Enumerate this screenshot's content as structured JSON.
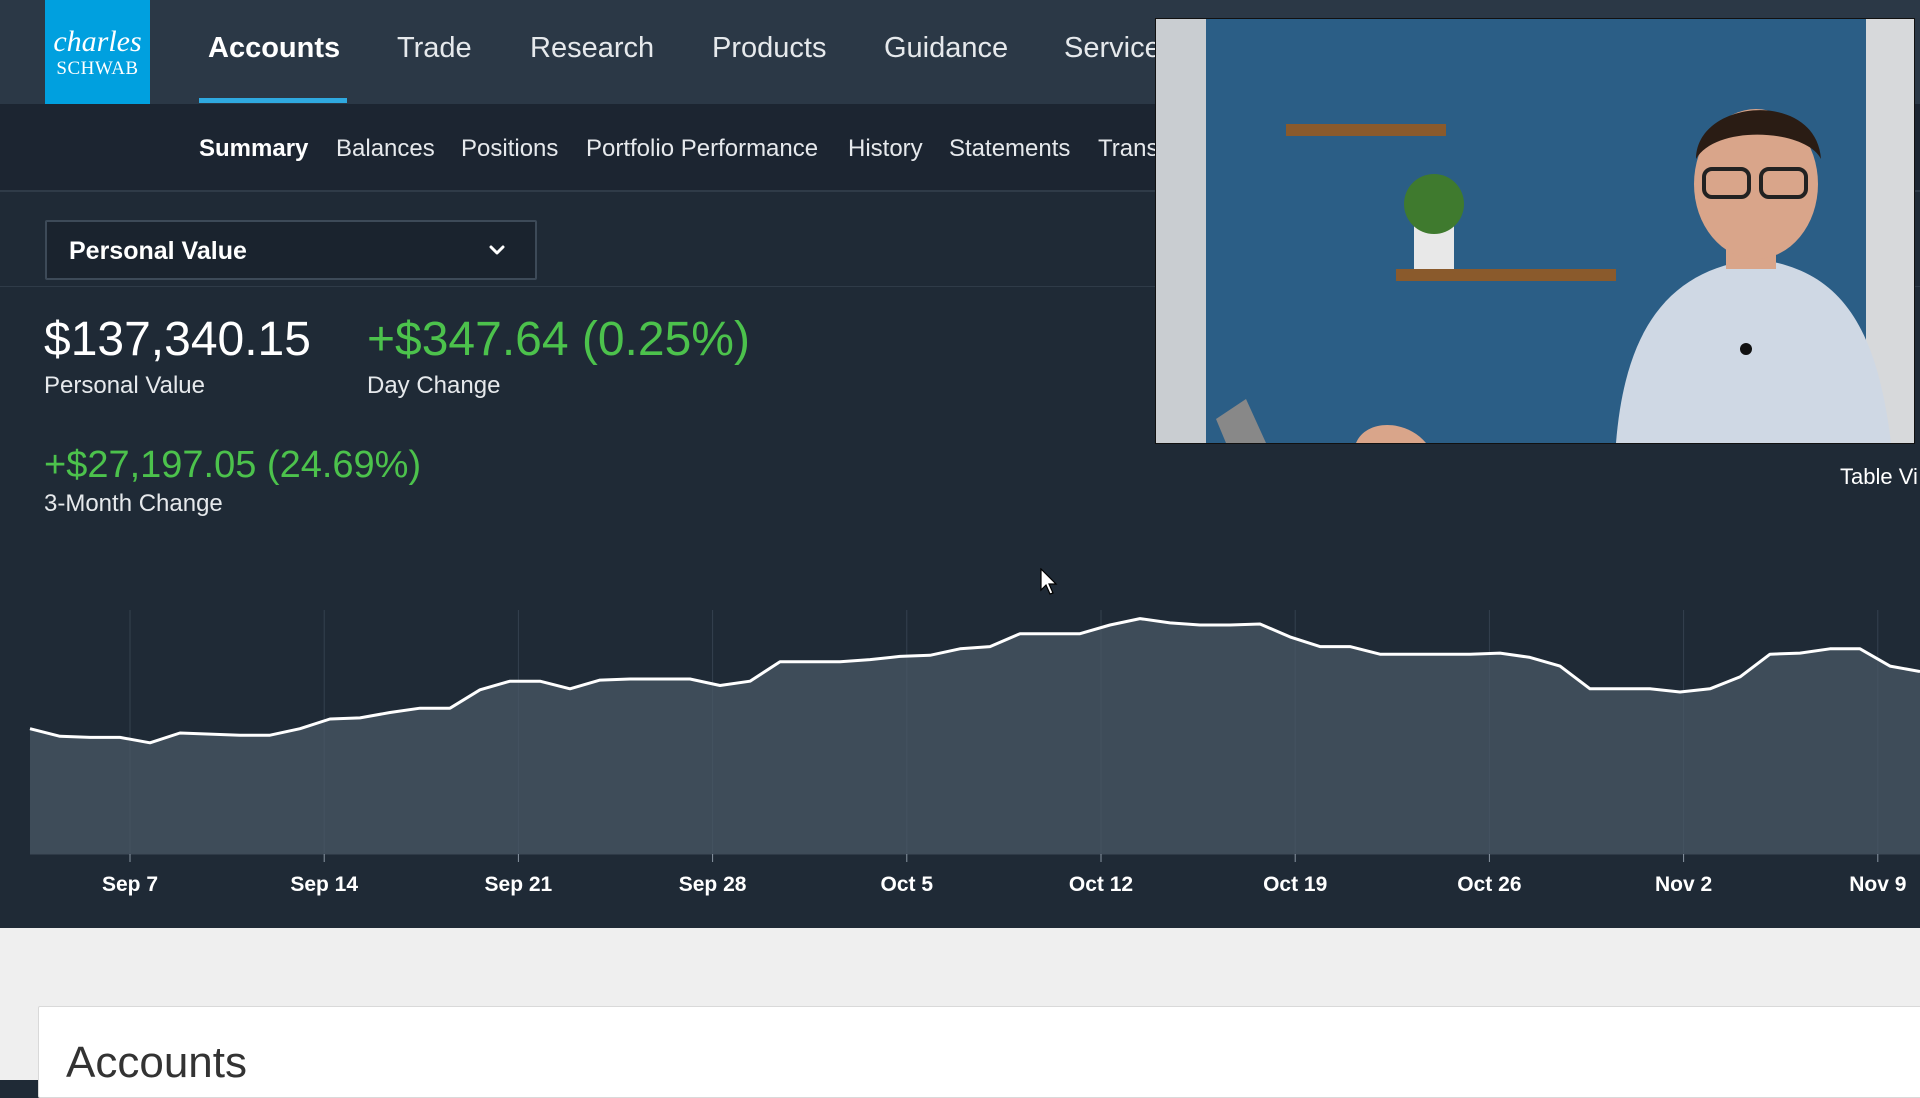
{
  "logo": {
    "line1": "charles",
    "line2": "SCHWAB",
    "color": "#00a0df"
  },
  "nav": {
    "items": [
      {
        "label": "Accounts",
        "active": true
      },
      {
        "label": "Trade"
      },
      {
        "label": "Research"
      },
      {
        "label": "Products"
      },
      {
        "label": "Guidance"
      },
      {
        "label": "Service"
      }
    ]
  },
  "subnav": {
    "items": [
      {
        "label": "Summary",
        "active": true
      },
      {
        "label": "Balances"
      },
      {
        "label": "Positions"
      },
      {
        "label": "Portfolio Performance"
      },
      {
        "label": "History"
      },
      {
        "label": "Statements"
      },
      {
        "label": "Trans"
      }
    ]
  },
  "selector": {
    "value": "Personal Value",
    "icon": "chevron-down-icon"
  },
  "summary": {
    "value": "$137,340.15",
    "value_label": "Personal Value",
    "day_change": "+$347.64 (0.25%)",
    "day_change_label": "Day Change",
    "three_month_change": "+$27,197.05 (24.69%)",
    "three_month_label": "3-Month Change"
  },
  "table_view_label": "Table Vi",
  "colors": {
    "positive": "#4cc24c",
    "accent": "#2fa9e0",
    "background": "#1f2a36"
  },
  "chart_data": {
    "type": "area",
    "x_ticks": [
      "Sep 7",
      "Sep 14",
      "Sep 21",
      "Sep 28",
      "Oct 5",
      "Oct 12",
      "Oct 19",
      "Oct 26",
      "Nov 2",
      "Nov 9"
    ],
    "values": [
      111.6,
      110.9,
      110.8,
      110.8,
      110.3,
      111.2,
      111.1,
      111.0,
      111.0,
      111.6,
      112.5,
      112.6,
      113.1,
      113.5,
      113.5,
      115.2,
      116.0,
      116.0,
      115.3,
      116.1,
      116.2,
      116.2,
      116.2,
      115.6,
      116.0,
      117.8,
      117.8,
      117.8,
      118.0,
      118.3,
      118.4,
      119.0,
      119.2,
      120.4,
      120.4,
      120.4,
      121.2,
      121.8,
      121.4,
      121.2,
      121.2,
      121.3,
      120.1,
      119.2,
      119.2,
      118.5,
      118.5,
      118.5,
      118.5,
      118.6,
      118.2,
      117.4,
      115.3,
      115.3,
      115.3,
      115.0,
      115.3,
      116.4,
      118.5,
      118.6,
      119.0,
      119.0,
      117.4,
      116.9
    ],
    "y_range": [
      100,
      130
    ],
    "grid_vertical": true
  }
}
